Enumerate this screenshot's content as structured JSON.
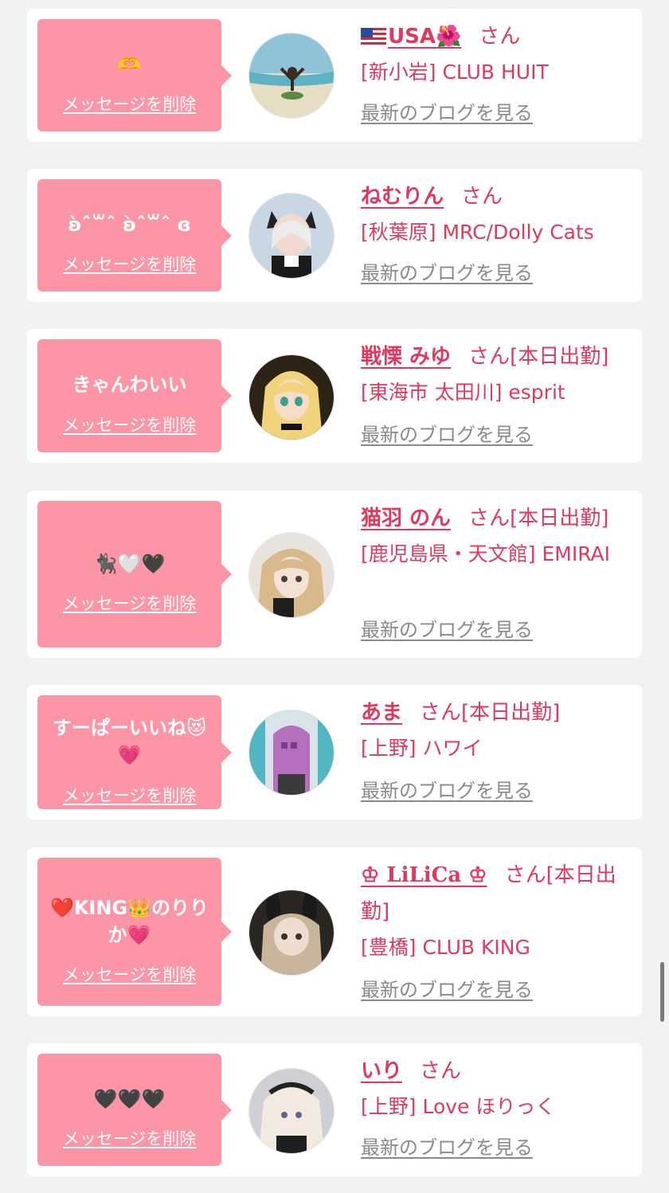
{
  "colors": {
    "background": "#f2f2f2",
    "card": "#ffffff",
    "bubble": "#fc95a6",
    "accent": "#e0395f",
    "blog_link": "#8a8a8a"
  },
  "common": {
    "honorific": "さん",
    "delete_label": "メッセージを削除",
    "blog_label": "最新のブログを見る"
  },
  "items": [
    {
      "message": "🫶",
      "name": "USA🌺",
      "name_prefix_icon": "usa-flag-icon",
      "badge": "",
      "shop": "[新小岩] CLUB HUIT",
      "avatar": "beach-photo"
    },
    {
      "message": "ʚ̀ˆ꒳ˆ ʚ̀ˆ꒳ˆ ɞ",
      "name": "ねむりん",
      "badge": "",
      "shop": "[秋葉原] MRC/Dolly Cats",
      "avatar": "cat-ear-cosplay-photo"
    },
    {
      "message": "きゃんわいい",
      "name": "戦慄 みゆ",
      "badge": "[本日出勤]",
      "shop": "[東海市 太田川] esprit",
      "avatar": "anime-girl-photo"
    },
    {
      "message": "🐈‍⬛🤍🖤",
      "name": "猫羽 のん",
      "badge": "[本日出勤]",
      "shop": "[鹿児島県・天文館] EMIRAI",
      "avatar": "blonde-girl-photo"
    },
    {
      "message": "すーぱーいいね😻💗",
      "name": "あま",
      "badge": "[本日出勤]",
      "shop": "[上野] ハワイ",
      "avatar": "pink-door-photo"
    },
    {
      "message": "❤️KING👑のりりか💗",
      "name": "♔ LiLiCa ♔",
      "badge": "[本日出勤]",
      "shop": "[豊橋] CLUB KING",
      "avatar": "bunny-ear-photo"
    },
    {
      "message": "🖤🖤🖤",
      "name": "いり",
      "badge": "",
      "shop": "[上野] Love ほりっく",
      "avatar": "maid-photo"
    }
  ]
}
